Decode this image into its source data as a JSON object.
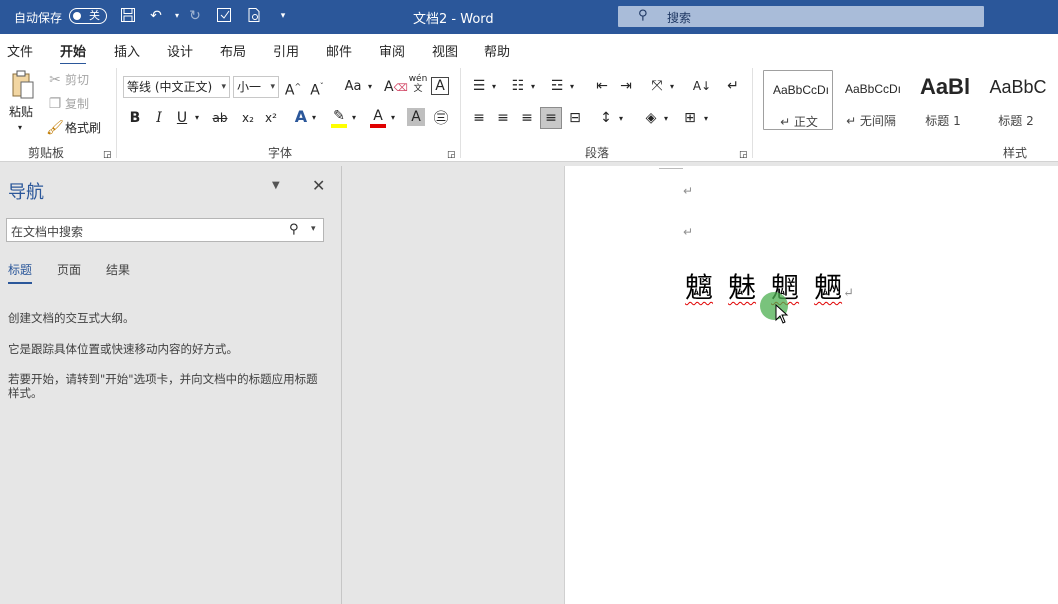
{
  "titlebar": {
    "autosave_label": "自动保存",
    "autosave_state": "关",
    "doc_title": "文档2  -  Word",
    "search_placeholder": "搜索"
  },
  "tabs": [
    "文件",
    "开始",
    "插入",
    "设计",
    "布局",
    "引用",
    "邮件",
    "审阅",
    "视图",
    "帮助"
  ],
  "active_tab": "开始",
  "ribbon": {
    "clipboard": {
      "paste": "粘贴",
      "cut": "剪切",
      "copy": "复制",
      "format_painter": "格式刷",
      "group": "剪贴板"
    },
    "font": {
      "font_name": "等线 (中文正文)",
      "font_size": "小一",
      "bold": "B",
      "italic": "I",
      "underline": "U",
      "strike": "ab",
      "sub": "x₂",
      "sup": "x²",
      "group": "字体",
      "aa": "Aa",
      "pinyin": "wén"
    },
    "paragraph": {
      "group": "段落"
    },
    "styles": {
      "group": "样式",
      "items": [
        {
          "sample": "AaBbCcDı",
          "name": "↵ 正文"
        },
        {
          "sample": "AaBbCcDı",
          "name": "↵ 无间隔"
        },
        {
          "sample": "AaBl",
          "name": "标题 1"
        },
        {
          "sample": "AaBbC",
          "name": "标题 2"
        }
      ]
    }
  },
  "nav": {
    "title": "导航",
    "search_placeholder": "在文档中搜索",
    "tabs": [
      "标题",
      "页面",
      "结果"
    ],
    "text1": "创建文档的交互式大纲。",
    "text2": "它是跟踪具体位置或快速移动内容的好方式。",
    "text3": "若要开始，请转到\"开始\"选项卡，并向文档中的标题应用标题样式。"
  },
  "document": {
    "paragraph_mark": "↵",
    "characters": [
      "魑",
      "魅",
      "魍",
      "魉"
    ]
  },
  "colors": {
    "brand": "#2b579a",
    "highlight": "#ffff00",
    "font_color": "#e00000",
    "spell_underline": "#e00000",
    "click_indicator": "#4caf50"
  }
}
